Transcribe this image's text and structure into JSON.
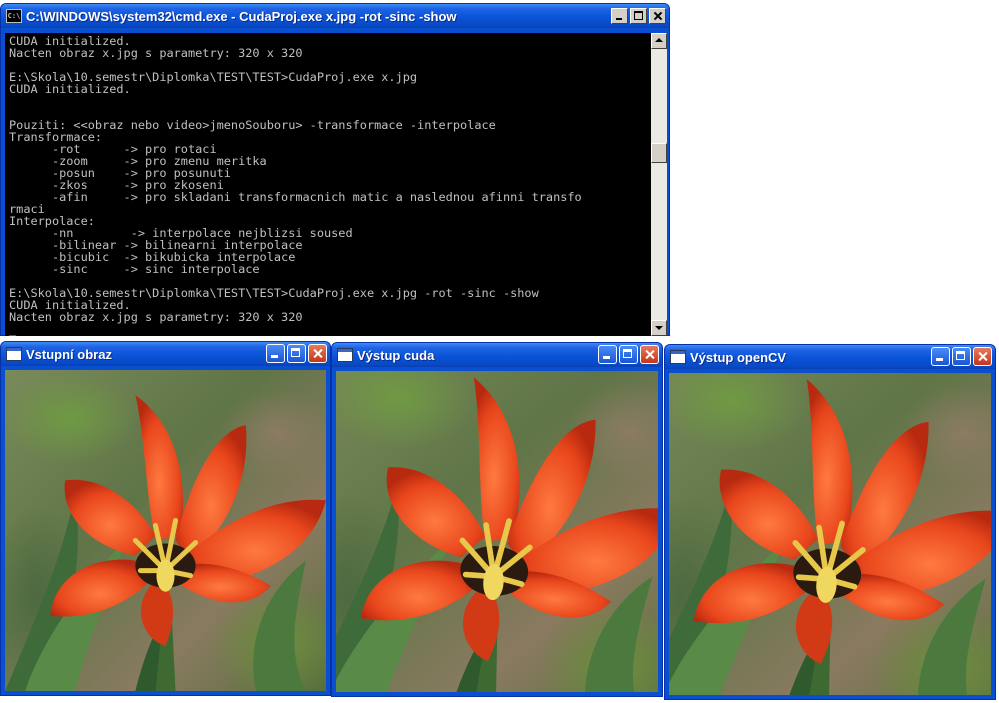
{
  "cmd_window": {
    "title": "C:\\WINDOWS\\system32\\cmd.exe - CudaProj.exe  x.jpg -rot -sinc -show",
    "icon": "cmd-icon",
    "console_text": "CUDA initialized.\nNacten obraz x.jpg s parametry: 320 x 320\n\nE:\\Skola\\10.semestr\\Diplomka\\TEST\\TEST>CudaProj.exe x.jpg\nCUDA initialized.\n\n\nPouziti: <<obraz nebo video>jmenoSouboru> -transformace -interpolace\nTransformace:\n      -rot      -> pro rotaci\n      -zoom     -> pro zmenu meritka\n      -posun    -> pro posunuti\n      -zkos     -> pro zkoseni\n      -afin     -> pro skladani transformacnich matic a naslednou afinni transfo\nrmaci\nInterpolace:\n      -nn        -> interpolace nejblizsi soused\n      -bilinear -> bilinearni interpolace\n      -bicubic  -> bikubicka interpolace\n      -sinc     -> sinc interpolace\n\nE:\\Skola\\10.semestr\\Diplomka\\TEST\\TEST>CudaProj.exe x.jpg -rot -sinc -show\nCUDA initialized.\nNacten obraz x.jpg s parametry: 320 x 320\n_"
  },
  "image_windows": [
    {
      "title": "Vstupní obraz",
      "rotation_deg": 0
    },
    {
      "title": "Výstup cuda",
      "rotation_deg": 4
    },
    {
      "title": "Výstup openCV",
      "rotation_deg": 4
    }
  ],
  "colors": {
    "xp_blue": "#0a54d8",
    "console_bg": "#000000",
    "console_fg": "#c0c0c0",
    "petal": "#e8461c",
    "petal_highlight": "#ff7a40",
    "stamen": "#e8c84a"
  }
}
